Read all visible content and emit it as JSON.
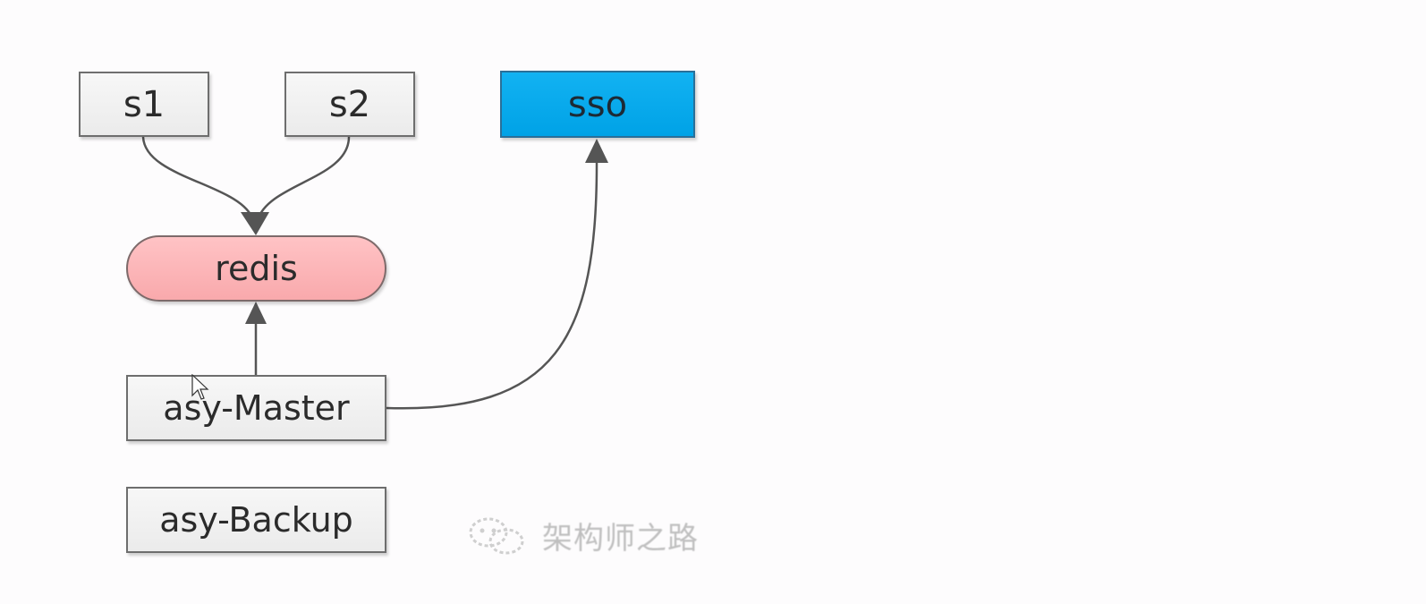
{
  "nodes": {
    "s1": "s1",
    "s2": "s2",
    "sso": "sso",
    "redis": "redis",
    "master": "asy-Master",
    "backup": "asy-Backup"
  },
  "edges": [
    {
      "from": "s1",
      "to": "redis"
    },
    {
      "from": "s2",
      "to": "redis"
    },
    {
      "from": "asy-Master",
      "to": "redis"
    },
    {
      "from": "asy-Master",
      "to": "sso"
    }
  ],
  "watermark": {
    "text": "架构师之路"
  },
  "colors": {
    "sso_fill": "#00a2e6",
    "redis_fill": "#f9a9ac",
    "default_fill": "#f0f0f0",
    "edge": "#555555"
  }
}
